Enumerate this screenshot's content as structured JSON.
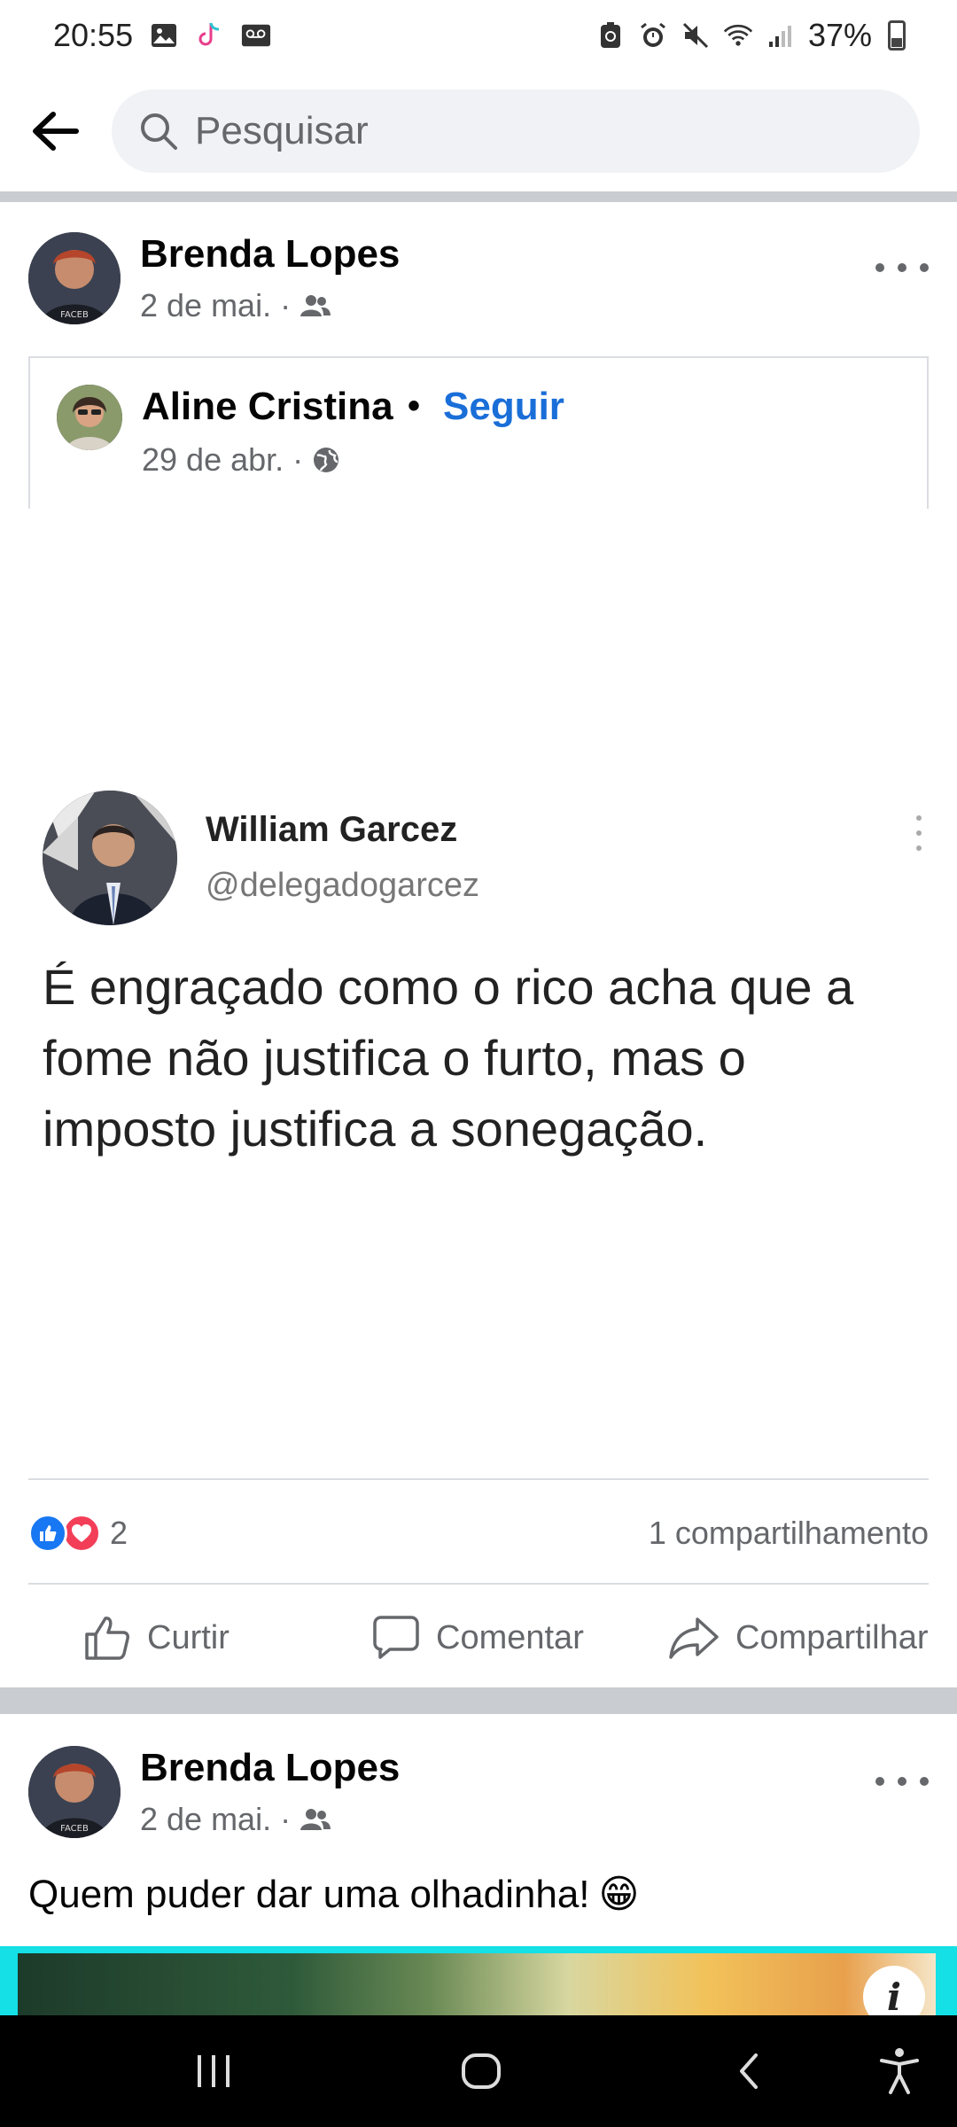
{
  "status_bar": {
    "time": "20:55",
    "battery": "37%",
    "left_icons": [
      "gallery-icon",
      "tiktok-icon",
      "voicemail-icon"
    ],
    "right_icons": [
      "nfc-icon",
      "alarm-icon",
      "mute-icon",
      "wifi-icon",
      "signal-icon",
      "battery-icon"
    ]
  },
  "search": {
    "placeholder": "Pesquisar"
  },
  "posts": [
    {
      "author": "Brenda Lopes",
      "date": "2 de mai.",
      "separator": "·",
      "privacy_icon": "friends-icon",
      "shared": {
        "author": "Aline Cristina",
        "bullet": "•",
        "follow_label": "Seguir",
        "date": "29 de abr.",
        "separator": "·",
        "privacy_icon": "globe-icon",
        "tweet": {
          "name": "William Garcez",
          "handle": "@delegadogarcez",
          "text": "É engraçado como o rico acha que a fome não justifica o furto, mas o imposto justifica a sonegação."
        }
      },
      "reaction_count": "2",
      "shares": "1 compartilhamento",
      "actions": {
        "like": "Curtir",
        "comment": "Comentar",
        "share": "Compartilhar"
      }
    },
    {
      "author": "Brenda Lopes",
      "date": "2 de mai.",
      "separator": "·",
      "privacy_icon": "friends-icon",
      "text": "Quem puder dar uma olhadinha!",
      "emoji": "😁",
      "info_label": "i"
    }
  ],
  "colors": {
    "accent": "#1877f2",
    "follow": "#1a6ed8",
    "secondary_text": "#65676b",
    "divider": "#c9ccd1",
    "image_strip": "#14e0e6"
  }
}
